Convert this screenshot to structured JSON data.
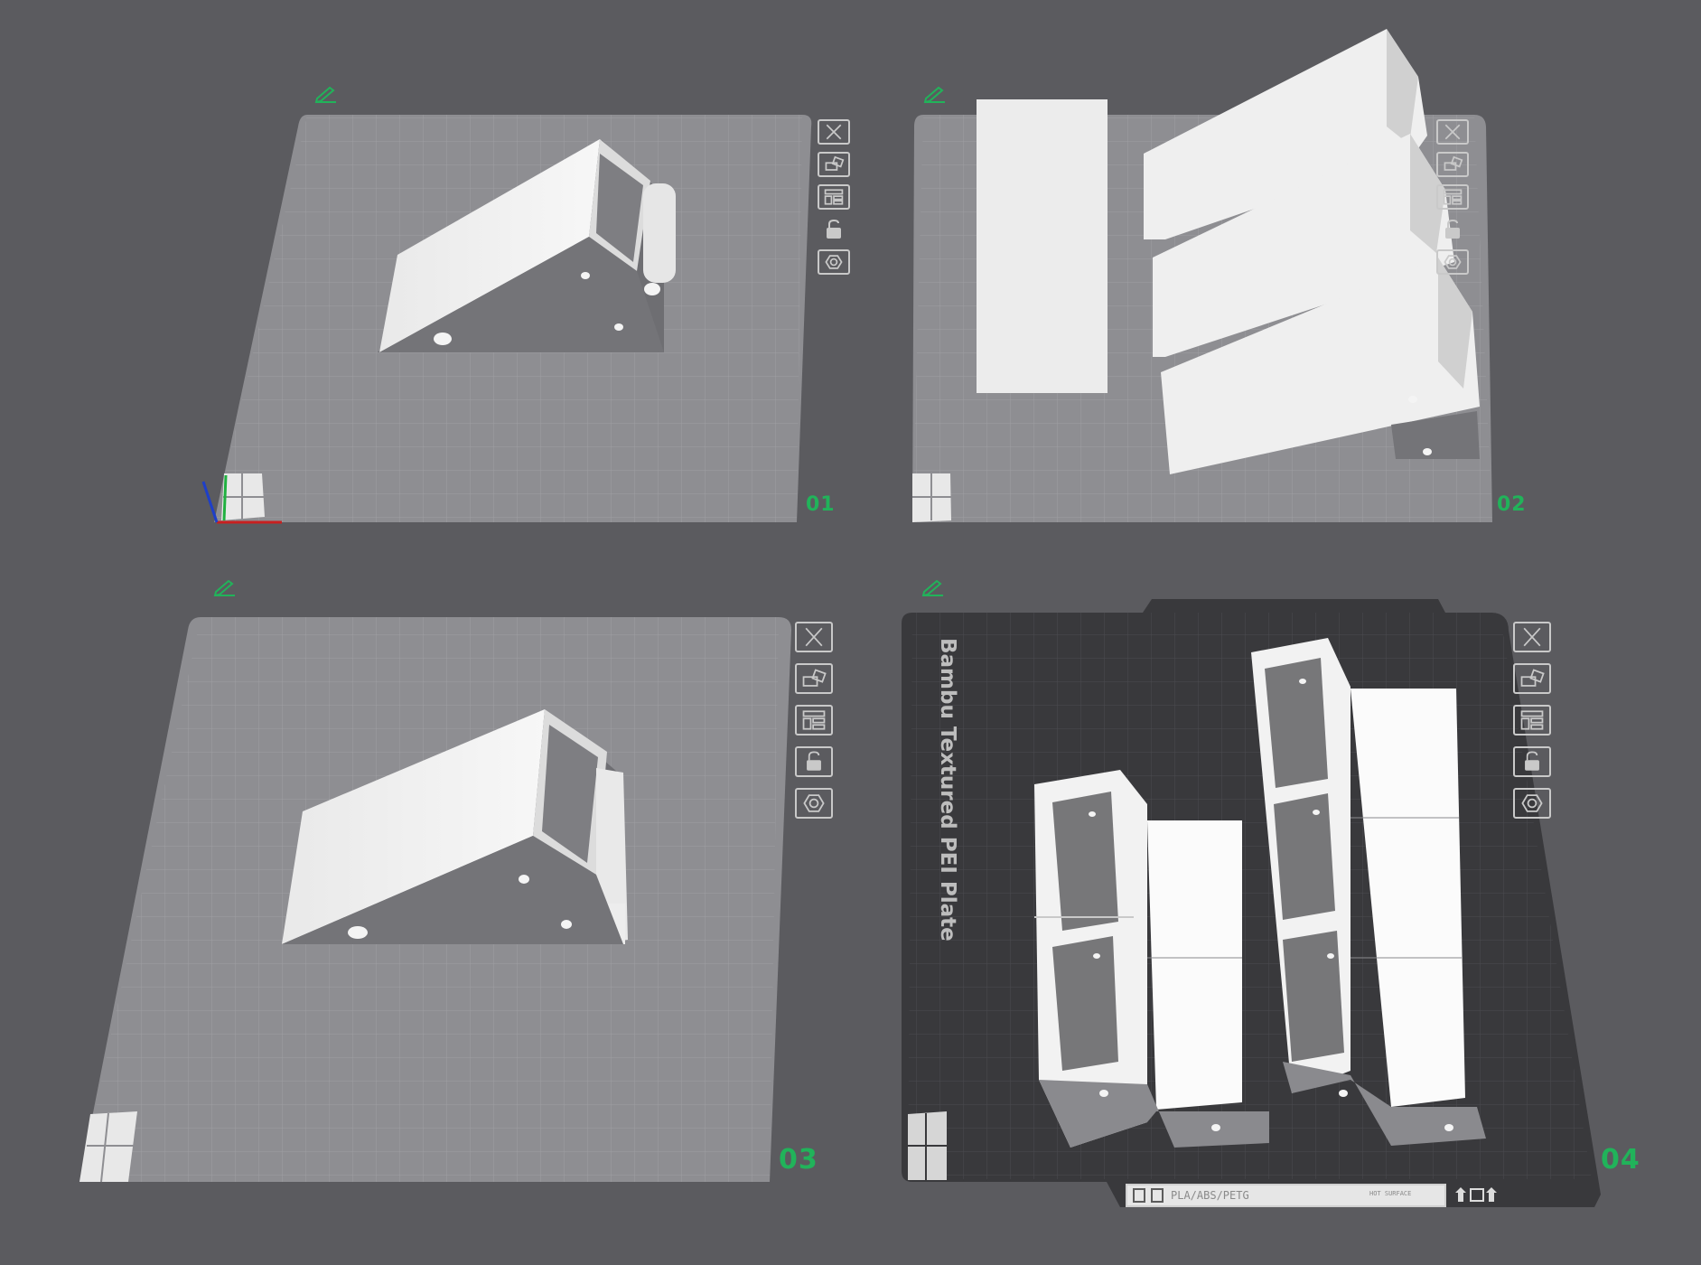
{
  "plates": [
    {
      "number": "01"
    },
    {
      "number": "02"
    },
    {
      "number": "03"
    },
    {
      "number": "04",
      "surface_label": "Bambu Textured PEI Plate",
      "strip_text": "PLA/ABS/PETG",
      "strip_badge": "HOT SURFACE"
    }
  ],
  "icons": {
    "edit": "pencil-icon",
    "close": "close-icon",
    "arrange": "auto-orient-icon",
    "layout": "arrange-icon",
    "lock": "lock-icon",
    "settings": "plate-settings-icon"
  },
  "colors": {
    "background": "#5b5b5f",
    "plate_light": "#8d8d91",
    "plate_dark": "#39393c",
    "accent_green": "#21b35a",
    "model_face": "#f0f0f0",
    "model_shadow": "#7a7a7d"
  }
}
